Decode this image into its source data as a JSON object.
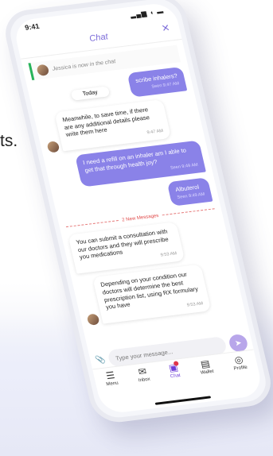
{
  "background": {
    "text": "ts."
  },
  "status": {
    "time": "9:41",
    "signal": "▂▄▆ ◖ ▬"
  },
  "header": {
    "title": "Chat",
    "close_icon": "×"
  },
  "system": {
    "joined": "Jessica is now in the chat"
  },
  "messages": {
    "today": "Today",
    "m1": {
      "text": "scribe inhalers?",
      "time": "Seen  9:47 AM"
    },
    "m2": {
      "text": "Meanwhile, to save time, if there are any additional details please write them here",
      "time": "9:47 AM"
    },
    "m3": {
      "text": "I need a refill on an inhaler am I able to get that through health joy?",
      "time": "Seen  9:49 AM"
    },
    "m4": {
      "text": "Albuterol",
      "time": "Seen  9:49 AM"
    },
    "divider": "2 New Messages",
    "m5": {
      "text": "You can submit a consultation with our doctors and they will prescribe you medications",
      "time": "9:53 AM"
    },
    "m6": {
      "text": "Depending on your condition our doctors will determine the best prescription list, using RX formulary you have",
      "time": "9:53 AM"
    }
  },
  "composer": {
    "placeholder": "Type your message..."
  },
  "tabs": [
    {
      "label": "Menu",
      "icon": "☰"
    },
    {
      "label": "Inbox",
      "icon": "✉"
    },
    {
      "label": "Chat",
      "icon": "▣"
    },
    {
      "label": "Wallet",
      "icon": "▤"
    },
    {
      "label": "Profile",
      "icon": "◎"
    }
  ],
  "colors": {
    "accent": "#7c6cd9",
    "bubble_out": "#8a82e8",
    "divider": "#e04a4a",
    "online": "#27b35a"
  }
}
